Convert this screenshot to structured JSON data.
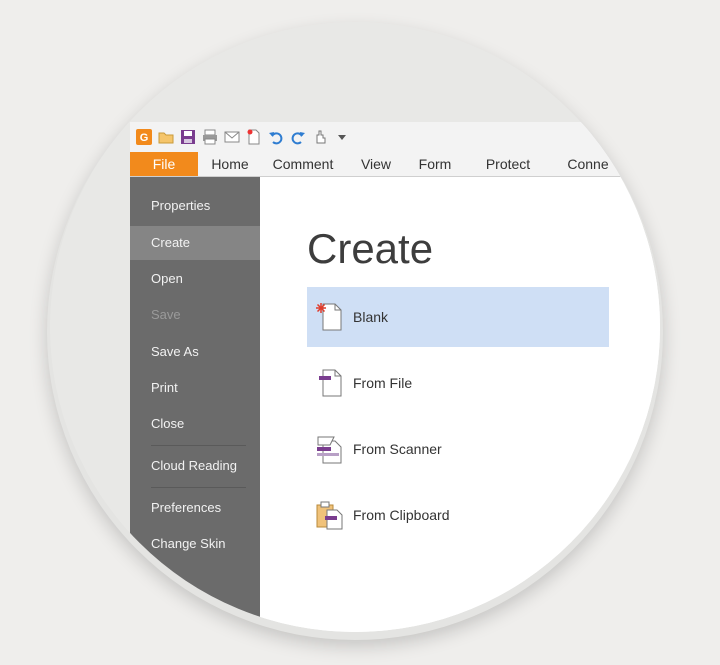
{
  "app": {
    "logo_letter": "G"
  },
  "tabs": [
    {
      "label": "File"
    },
    {
      "label": "Home"
    },
    {
      "label": "Comment"
    },
    {
      "label": "View"
    },
    {
      "label": "Form"
    },
    {
      "label": "Protect"
    },
    {
      "label": "Conne"
    }
  ],
  "sidebar": {
    "items": [
      {
        "label": "Properties"
      },
      {
        "label": "Create"
      },
      {
        "label": "Open"
      },
      {
        "label": "Save"
      },
      {
        "label": "Save As"
      },
      {
        "label": "Print"
      },
      {
        "label": "Close"
      },
      {
        "label": "Cloud Reading"
      },
      {
        "label": "Preferences"
      },
      {
        "label": "Change Skin"
      }
    ]
  },
  "main": {
    "title": "Create",
    "options": [
      {
        "label": "Blank",
        "icon": "blank-document-icon"
      },
      {
        "label": "From File",
        "icon": "from-file-icon"
      },
      {
        "label": "From Scanner",
        "icon": "scanner-icon"
      },
      {
        "label": "From Clipboard",
        "icon": "clipboard-icon"
      }
    ]
  },
  "colors": {
    "accent": "#f28a1c",
    "sidebar": "#6b6b6b",
    "sidebar_active": "#858585",
    "selected": "#cfdff5",
    "purple": "#7a3d8f"
  }
}
